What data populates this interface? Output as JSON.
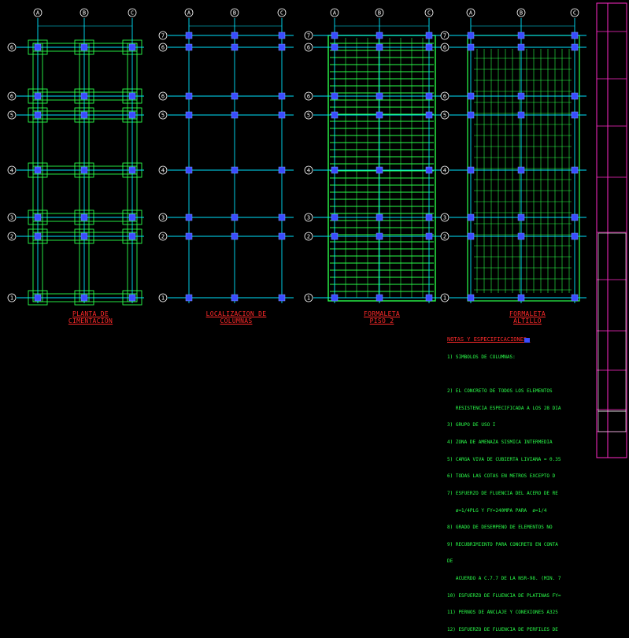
{
  "plans": [
    {
      "title_lines": [
        "PLANTA DE",
        "CIMENTACION"
      ]
    },
    {
      "title_lines": [
        "LOCALIZACION DE",
        "COLUMNAS"
      ]
    },
    {
      "title_lines": [
        "FORMALETA",
        "PISO 2"
      ]
    },
    {
      "title_lines": [
        "FORMALETA",
        "ALTILLO"
      ]
    }
  ],
  "column_axes": [
    "A",
    "B",
    "C"
  ],
  "row_axes_full": [
    "7",
    "6",
    "5",
    "4",
    "3",
    "2",
    "1"
  ],
  "row_axes_short": [
    "6",
    "5",
    "4",
    "3",
    "2",
    "1"
  ],
  "notes": {
    "title": "NOTAS Y ESPECIFICACIONES:",
    "lines": [
      "1) SIMBOLOS DE COLUMNAS:",
      "",
      "2) EL CONCRETO DE TODOS LOS ELEMENTOS",
      "   RESISTENCIA ESPECIFICADA A LOS 28 DIA",
      "3) GRUPO DE USO I",
      "4) ZONA DE AMENAZA SISMICA INTERMEDIA",
      "5) CARGA VIVA DE CUBIERTA LIVIANA = 0.35",
      "6) TODAS LAS COTAS EN METROS EXCEPTO D",
      "7) ESFUERZO DE FLUENCIA DEL ACERO DE RE",
      "   ø=1/4PLG Y FY=240MPA PARA  ø=1/4",
      "8) GRADO DE DESEMPEÑO DE ELEMENTOS NO",
      "9) RECUBRIMIENTO PARA CONCRETO EN CONTA",
      "DE",
      "   ACUERDO A C.7.7 DE LA NSR-98. (MIN. 7",
      "10) ESFUERZO DE FLUENCIA DE PLATINAS FY=",
      "11) PERNOS DE ANCLAJE Y CONEXIONES A325",
      "12) ESFUERZO DE FLUENCIA DE PERFILES DE"
    ]
  },
  "colors": {
    "background": "#000000",
    "axis": "#00e5ff",
    "structure": "#2aff4a",
    "columns": "#3a4cff",
    "titles": "#ff2a2a",
    "frame": "#ff2ac8",
    "bubble": "#ffffff"
  }
}
